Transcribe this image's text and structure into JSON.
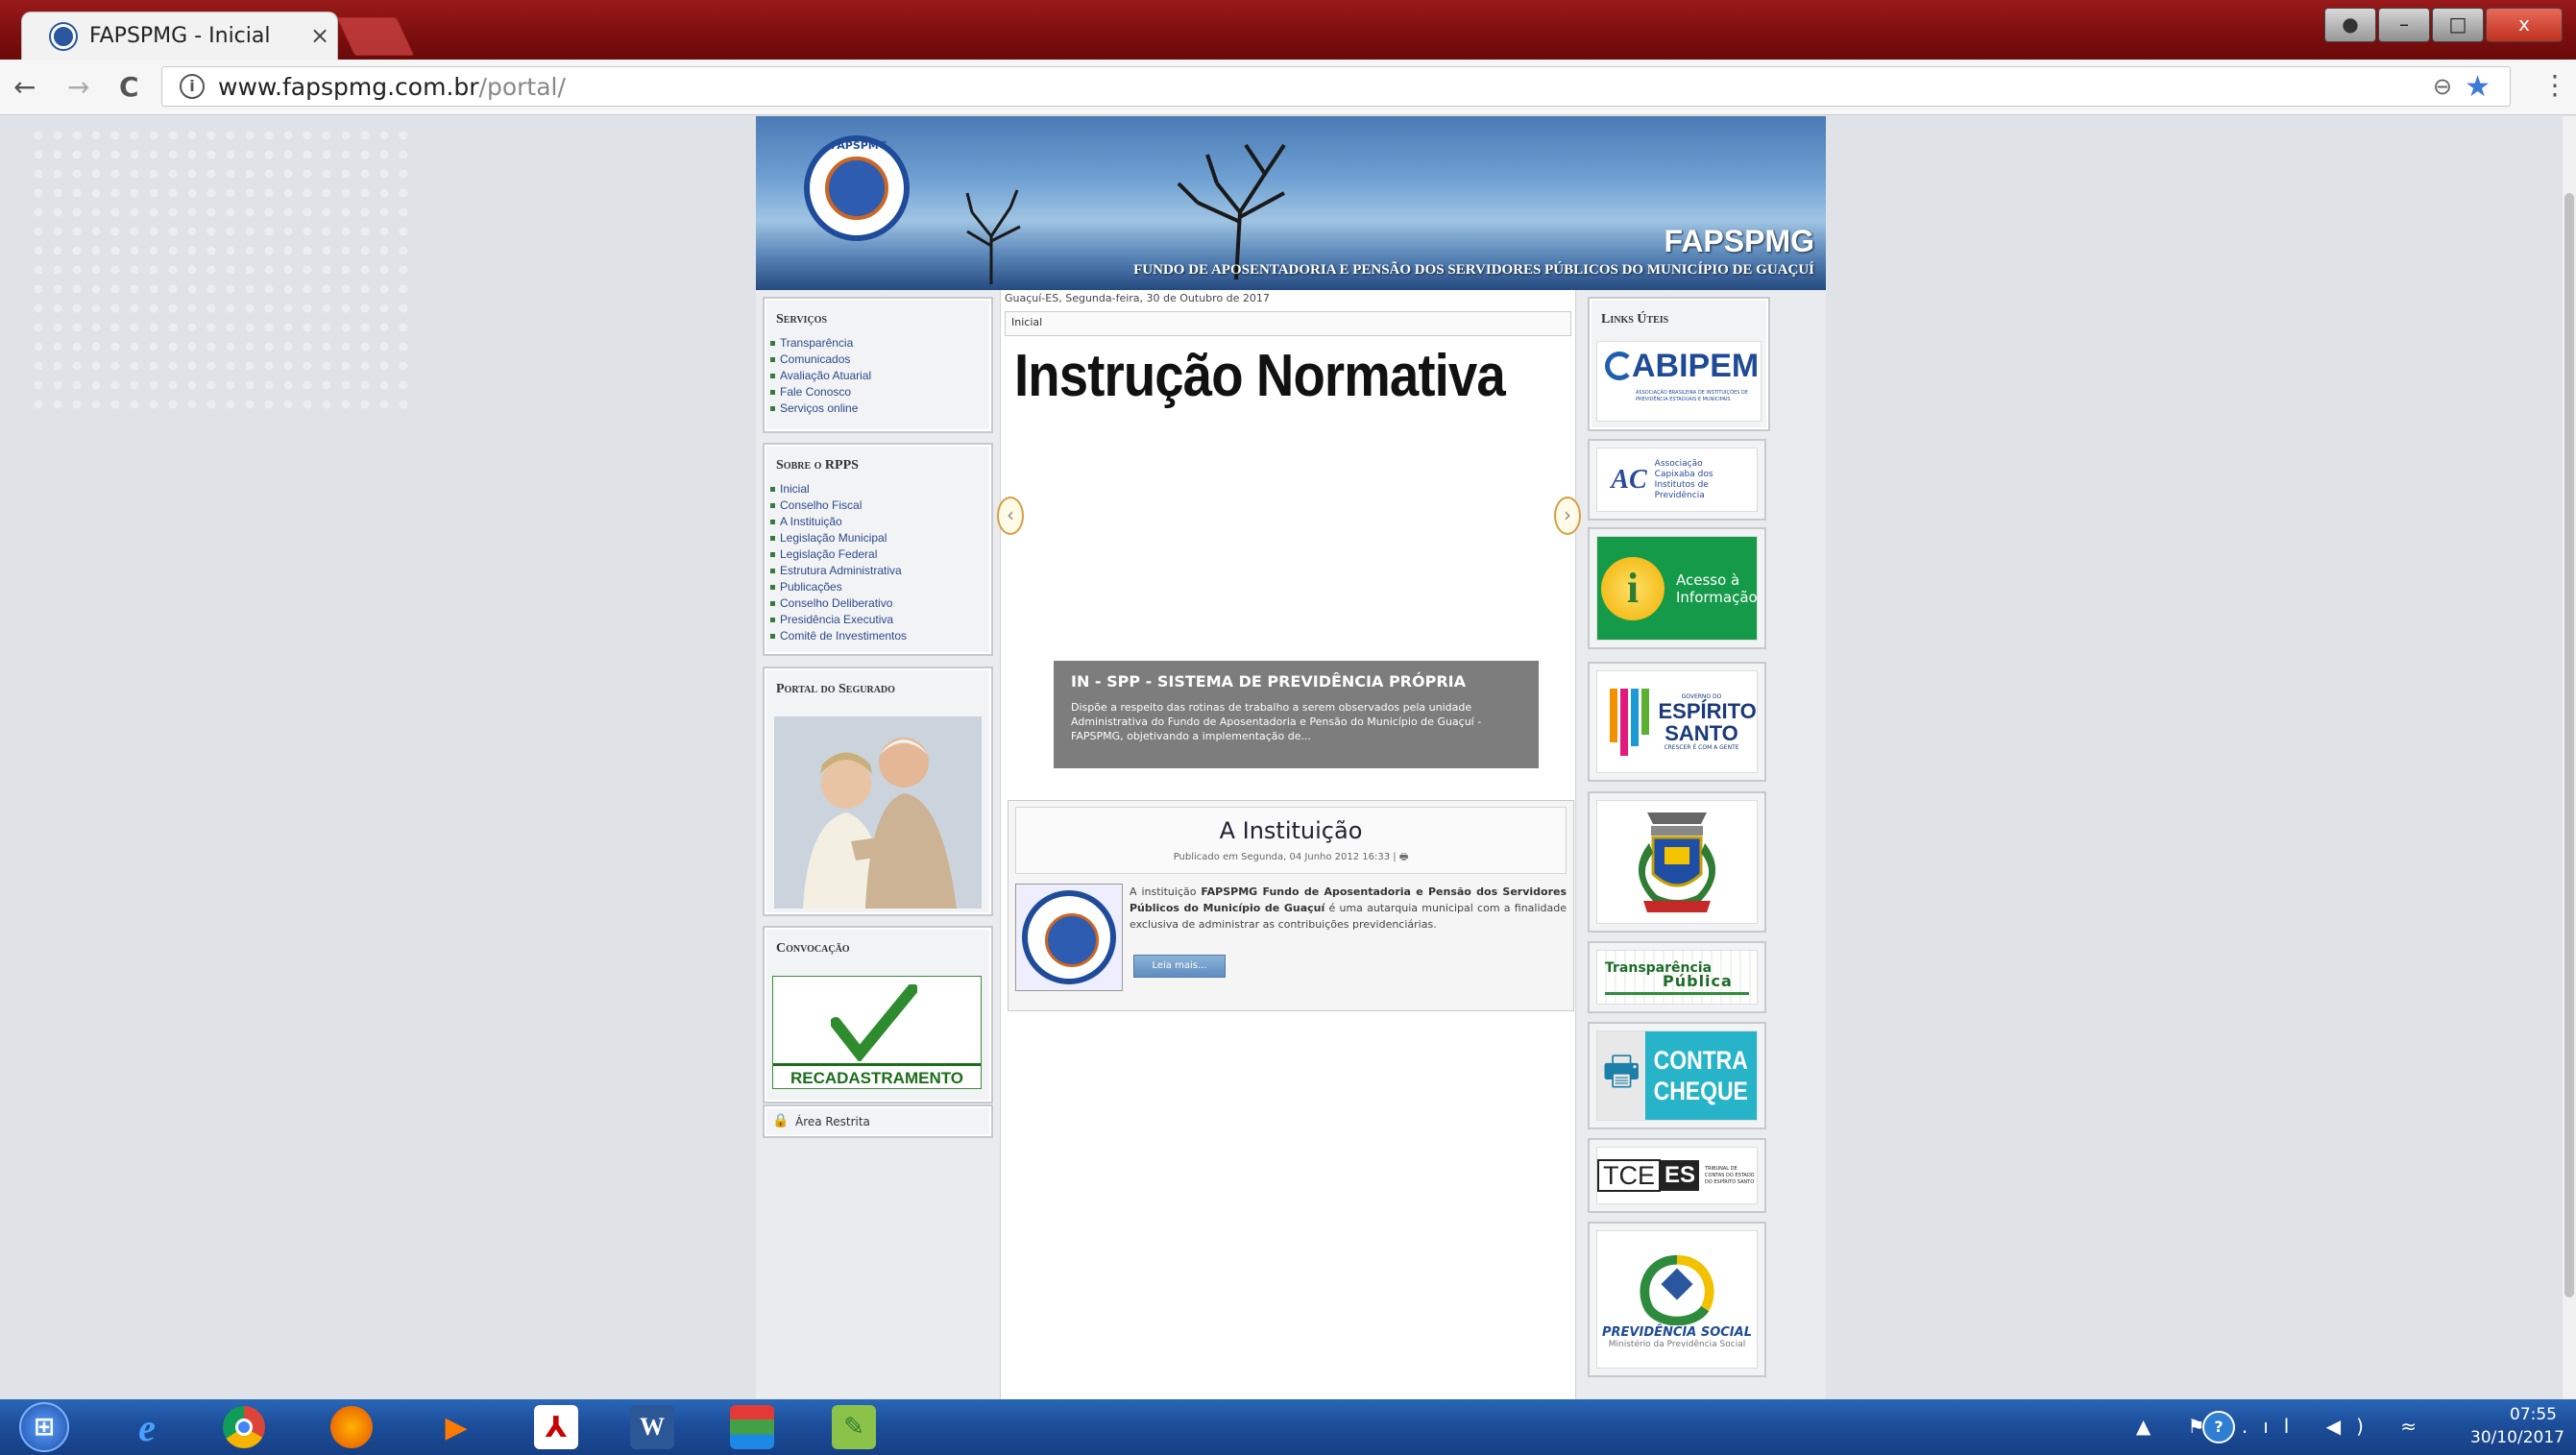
{
  "browser": {
    "tab_title": "FAPSPMG - Inicial",
    "tab_close": "×",
    "url_host": "www.fapspmg.com.br",
    "url_path": "/portal/",
    "back": "←",
    "forward": "→",
    "reload": "C",
    "info": "i",
    "window_controls": {
      "min": "–",
      "max": "□",
      "close": "x"
    }
  },
  "banner": {
    "brand": "FAPSPMG",
    "subtitle": "FUNDO DE APOSENTADORIA E PENSÃO DOS SERVIDORES PÚBLICOS DO MUNICÍPIO DE GUAÇUÍ",
    "logo_text": "FAPSPMG"
  },
  "left": {
    "servicos": {
      "title": "Serviços",
      "items": [
        "Transparência",
        "Comunicados",
        "Avaliação Atuarial",
        "Fale Conosco",
        "Serviços online"
      ]
    },
    "rpps": {
      "title": "Sobre o RPPS",
      "items": [
        "Inicial",
        "Conselho Fiscal",
        "A Instituição",
        "Legislação Municipal",
        "Legislação Federal",
        "Estrutura Administrativa",
        "Publicações",
        "Conselho Deliberativo",
        "Presidência Executiva",
        "Comitê de Investimentos"
      ]
    },
    "portal": {
      "title": "Portal do Segurado"
    },
    "convocacao": {
      "title": "Convocação",
      "banner_text": "RECADASTRAMENTO"
    },
    "area_restrita": "Área Restrita"
  },
  "center": {
    "date": "Guaçuí-ES, Segunda-feira, 30 de Outubro de 2017",
    "breadcrumb": "Inicial",
    "slide_heading": "Instrução Normativa",
    "slide_caption_title": "IN - SPP - SISTEMA DE PREVIDÊNCIA PRÓPRIA",
    "slide_caption_text": "Dispõe a respeito das rotinas de trabalho a serem observados pela unidade Administrativa do Fundo de Aposentadoria e Pensão do Município de Guaçuí - FAPSPMG, objetivando a implementação de...",
    "article": {
      "title": "A Instituição",
      "meta": "Publicado em Segunda, 04 Junho 2012 16:33 |",
      "body_prefix": "A instituição",
      "body_bold": "FAPSPMG Fundo de Aposentadoria e Pensão dos Servidores Públicos do Município de Guaçuí",
      "body_suffix": "é uma autarquia municipal com a finalidade exclusiva de administrar as contribuições previdenciárias.",
      "more": "Leia mais..."
    }
  },
  "right": {
    "title": "Links Úteis",
    "links": {
      "abipem": "ABIPEM",
      "abipem_sub": "ASSOCIAÇÃO BRASILEIRA DE INSTITUIÇÕES DE PREVIDÊNCIA ESTADUAIS E MUNICIPAIS",
      "acip": "Associação Capixaba dos Institutos de Previdência",
      "acesso": "Acesso à Informação",
      "es_top": "GOVERNO DO",
      "es_main": "ESPÍRITO SANTO",
      "es_sub": "CRESCER É COM A GENTE",
      "transp_1": "Transparência",
      "transp_2": "Pública",
      "contra_1": "CONTRA",
      "contra_2": "CHEQUE",
      "tce": "TCE",
      "tce_es": "ES",
      "tce_sub": "TRIBUNAL DE CONTAS DO ESTADO DO ESPÍRITO SANTO",
      "prev": "PREVIDÊNCIA SOCIAL",
      "prev_sub": "Ministério da Previdência Social"
    }
  },
  "taskbar": {
    "time": "07:55",
    "date": "30/10/2017",
    "help": "?",
    "tray": "▲ ⚑ .ıl ◀) ≈"
  }
}
